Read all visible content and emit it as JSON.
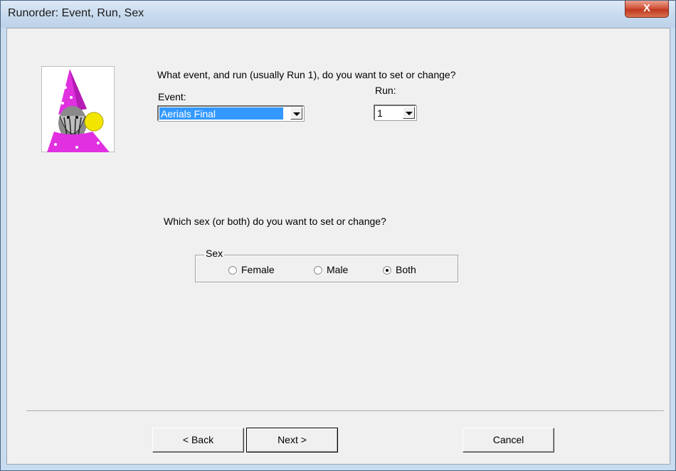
{
  "window": {
    "title": "Runorder: Event, Run, Sex",
    "close_glyph": "X"
  },
  "icons": {
    "close": "close-icon",
    "wizard": "wizard-icon",
    "dropdown": "chevron-down-icon"
  },
  "prompt_event": "What event, and run (usually Run 1), do you want to set or change?",
  "event": {
    "label": "Event:",
    "value": "Aerials Final"
  },
  "run": {
    "label": "Run:",
    "value": "1"
  },
  "prompt_sex": "Which sex (or both) do you want to set or change?",
  "sex": {
    "legend": "Sex",
    "options": [
      {
        "label": "Female",
        "selected": false
      },
      {
        "label": "Male",
        "selected": false
      },
      {
        "label": "Both",
        "selected": true
      }
    ]
  },
  "buttons": {
    "back": "< Back",
    "next": "Next >",
    "cancel": "Cancel"
  },
  "colors": {
    "selection": "#3399ff",
    "wizard_hat": "#e030e0",
    "close_red": "#c9412a"
  }
}
